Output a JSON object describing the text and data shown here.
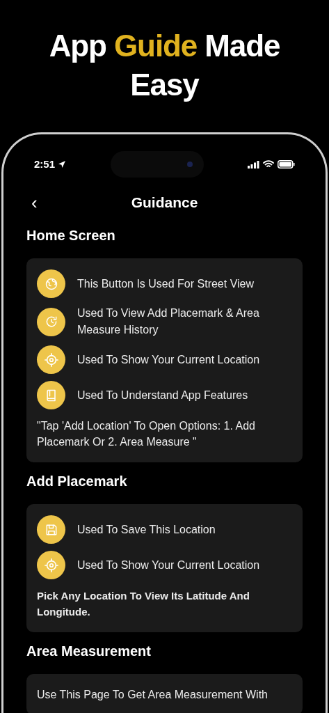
{
  "headline": [
    {
      "text": "App",
      "highlighted": false
    },
    {
      "text": "Guide",
      "highlighted": true
    },
    {
      "text": "Made",
      "highlighted": false
    },
    {
      "text": "Easy",
      "highlighted": false
    }
  ],
  "status_bar": {
    "time": "2:51"
  },
  "header": {
    "back": "‹",
    "title": "Guidance"
  },
  "sections": [
    {
      "title": "Home Screen",
      "items": [
        {
          "kind": "globe",
          "text": "This Button Is Used For Street View"
        },
        {
          "kind": "history",
          "text": "Used To View Add Placemark & Area Measure History"
        },
        {
          "kind": "target",
          "text": "Used To Show Your Current Location"
        },
        {
          "kind": "book",
          "text": "Used To Understand App Features"
        }
      ],
      "note": "\"Tap 'Add Location' To Open Options: 1. Add Placemark Or 2. Area Measure \"",
      "note_bold": false
    },
    {
      "title": "Add Placemark",
      "items": [
        {
          "kind": "save",
          "text": "Used To Save This Location"
        },
        {
          "kind": "target",
          "text": "Used To Show Your Current Location"
        }
      ],
      "note": "Pick Any Location To View Its Latitude And Longitude.",
      "note_bold": true
    },
    {
      "title": "Area Measurement",
      "note": "Use This Page To Get Area Measurement With",
      "note_bold": false
    }
  ]
}
